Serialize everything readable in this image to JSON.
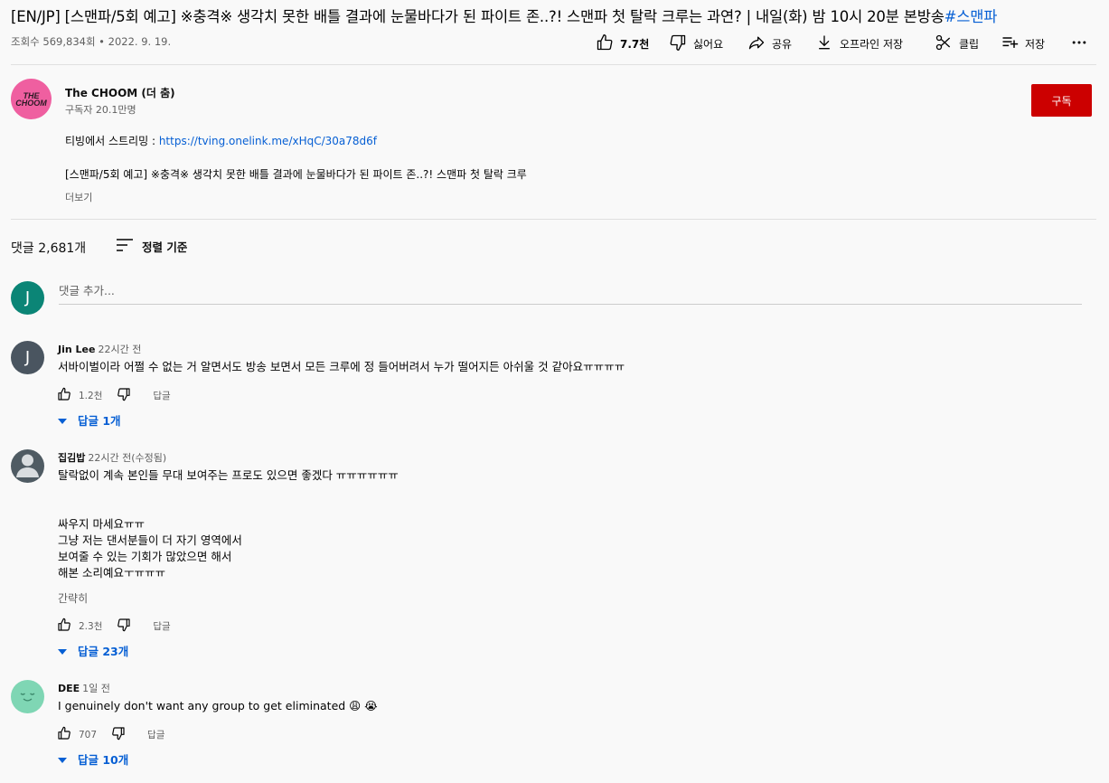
{
  "video": {
    "title_main": "[EN/JP] [스맨파/5회 예고] ※충격※ 생각치 못한 배틀 결과에 눈물바다가 된 파이트 존..?! 스맨파 첫 탈락 크루는 과연? | 내일(화) 밤 10시 20분 본방송",
    "title_hashtag": "#스맨파",
    "meta": "조회수 569,834회 • 2022. 9. 19."
  },
  "actions": {
    "like": "7.7천",
    "dislike": "싫어요",
    "share": "공유",
    "offline": "오프라인 저장",
    "clip": "클립",
    "save": "저장"
  },
  "channel": {
    "avatar_text": "THE CHOOM",
    "name": "The CHOOM (더 춤)",
    "subscribers": "구독자 20.1만명",
    "subscribe_label": "구독"
  },
  "description": {
    "line1_prefix": "티빙에서 스트리밍 : ",
    "line1_link": "https://tving.onelink.me/xHqC/30a78d6f",
    "line2": "[스맨파/5회 예고] ※충격※ 생각치 못한 배틀 결과에 눈물바다가 된 파이트 존..?! 스맨파 첫 탈락 크루",
    "more": "더보기"
  },
  "comments_header": {
    "count": "댓글 2,681개",
    "sort": "정렬 기준",
    "add_placeholder": "댓글 추가...",
    "me_initial": "J"
  },
  "comments": [
    {
      "initial": "J",
      "avatar_color": "#4a5560",
      "author": "Jin Lee",
      "time": "22시간 전",
      "lines": [
        "서바이벌이라 어쩔 수 없는 거 알면서도 방송 보면서 모든 크루에 정 들어버려서 누가 떨어지든 아쉬울 것 같아요ㅠㅠㅠㅠ"
      ],
      "likes": "1.2천",
      "reply": "답글",
      "replies": "답글 1개"
    },
    {
      "initial": "",
      "avatar_color": "#4f5b63",
      "author": "집김밥",
      "time": "22시간 전(수정됨)",
      "lines": [
        "탈락없이 계속 본인들 무대 보여주는 프로도 있으면 좋겠다 ㅠㅠㅠㅠㅠㅠ",
        "",
        "",
        "싸우지 마세요ㅠㅠ",
        "그냥 저는 댄서분들이 더 자기 영역에서",
        "보여줄 수 있는 기회가 많았으면 해서",
        "해본 소리예요ㅜㅠㅠㅠ"
      ],
      "short": "간략히",
      "likes": "2.3천",
      "reply": "답글",
      "replies": "답글 23개"
    },
    {
      "initial": "",
      "avatar_color": "#7fd6b4",
      "author": "DEE",
      "time": "1일 전",
      "lines": [
        "I genuinely don't want any group to get eliminated 😩 😭"
      ],
      "likes": "707",
      "reply": "답글",
      "replies": "답글 10개"
    }
  ]
}
